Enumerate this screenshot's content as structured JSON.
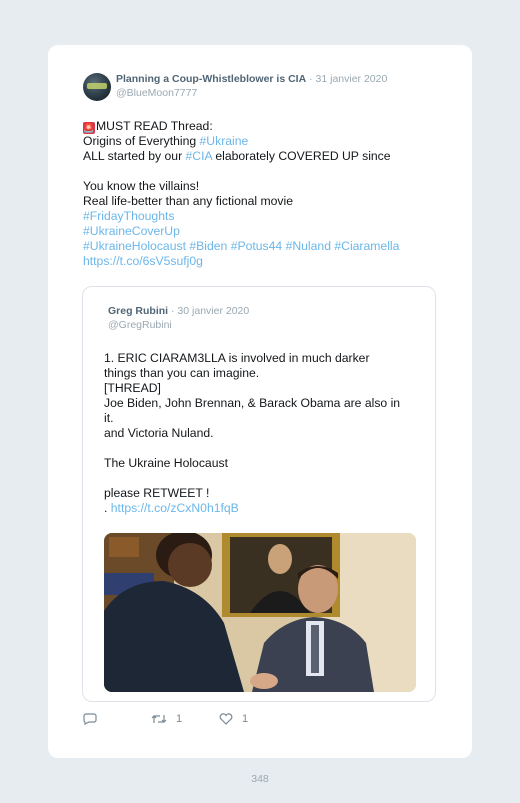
{
  "tweet": {
    "author_name": "Planning a Coup-Whistleblower is CIA",
    "date": "· 31 janvier 2020",
    "handle": "@BlueMoon7777",
    "emoji": "🚨",
    "lines": [
      [
        {
          "t": "MUST READ Thread:"
        }
      ],
      [
        {
          "t": "Origins of Everything "
        },
        {
          "t": "#Ukraine",
          "link": true
        }
      ],
      [
        {
          "t": "ALL started by our "
        },
        {
          "t": "#CIA",
          "link": true
        },
        {
          "t": " elaborately COVERED UP since"
        }
      ],
      [],
      [
        {
          "t": "You know the villains!"
        }
      ],
      [
        {
          "t": "Real life-better than any fictional movie"
        }
      ],
      [
        {
          "t": "#FridayThoughts",
          "link": true
        }
      ],
      [
        {
          "t": "#UkraineCoverUp",
          "link": true
        }
      ],
      [
        {
          "t": "#UkraineHolocaust #Biden #Potus44 #Nuland #Ciaramella",
          "link": true
        }
      ],
      [
        {
          "t": "https://t.co/6sV5sufj0g",
          "link": true
        }
      ]
    ]
  },
  "quoted": {
    "author_name": "Greg Rubini",
    "date": "· 30 janvier 2020",
    "handle": "@GregRubini",
    "lines": [
      [
        {
          "t": "1. ERIC CIARAM3LLA is involved in much darker things than you can imagine."
        }
      ],
      [
        {
          "t": "[THREAD]"
        }
      ],
      [
        {
          "t": "Joe Biden, John Brennan, & Barack Obama are also in it."
        }
      ],
      [
        {
          "t": "and Victoria Nuland."
        }
      ],
      [],
      [
        {
          "t": "The Ukraine Holocaust"
        }
      ],
      [],
      [
        {
          "t": "please RETWEET !"
        }
      ],
      [
        {
          "t": ". "
        },
        {
          "t": "https://t.co/zCxN0h1fqB",
          "link": true
        }
      ]
    ]
  },
  "actions": {
    "reply_icon": "reply-icon",
    "retweet_icon": "retweet-icon",
    "like_icon": "heart-icon",
    "retweet_count": "1",
    "like_count": "1"
  },
  "page_number": "348",
  "colors": {
    "link": "#6bb7ea",
    "name": "#506575",
    "meta": "#9aa8b2",
    "background": "#e6ecf0"
  }
}
